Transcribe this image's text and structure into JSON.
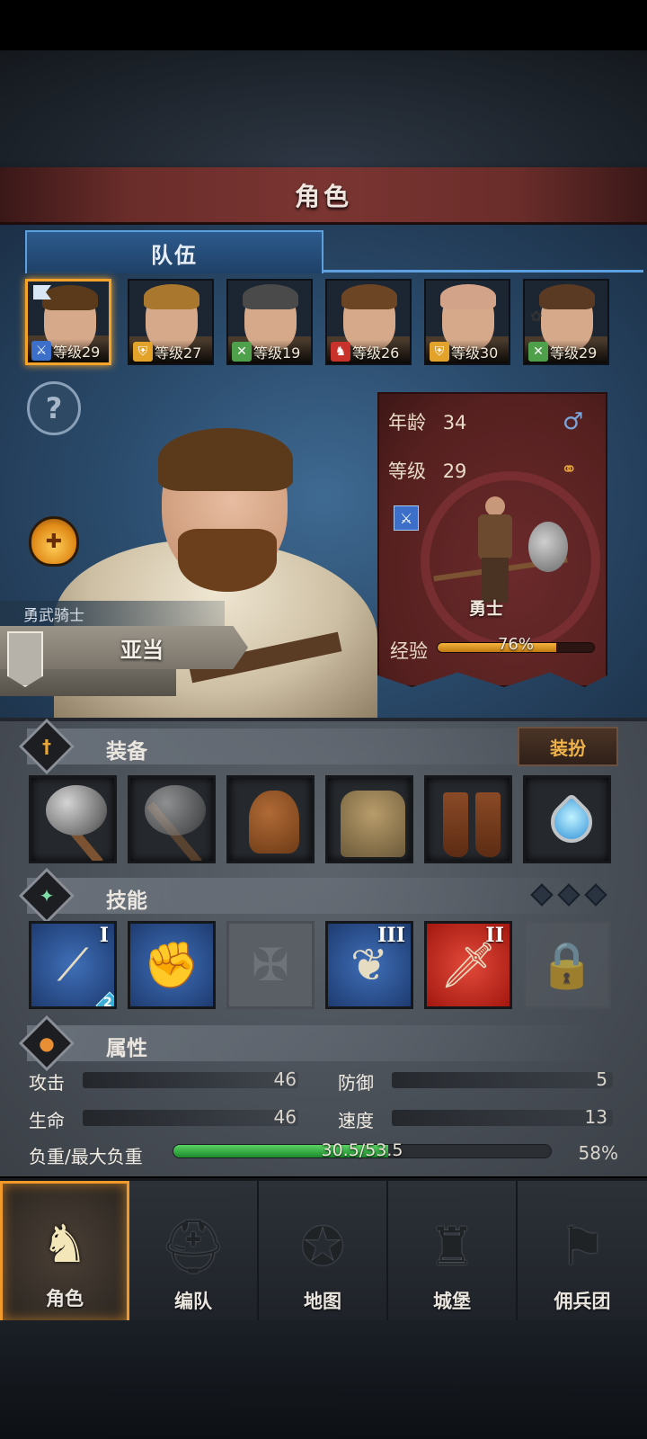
{
  "header": {
    "title": "角色"
  },
  "team": {
    "tab_label": "队伍",
    "members": [
      {
        "level_text": "等级29",
        "class_icon": "sword-icon",
        "color": "#3c6fc9",
        "hair": "#5b3a1c"
      },
      {
        "level_text": "等级27",
        "class_icon": "shield-icon",
        "color": "#e3a22a",
        "hair": "#a9772e"
      },
      {
        "level_text": "等级19",
        "class_icon": "crossed-swords-icon",
        "color": "#4fa04a",
        "hair": "#4a4a4a"
      },
      {
        "level_text": "等级26",
        "class_icon": "horse-icon",
        "color": "#c9312b",
        "hair": "#6b4524"
      },
      {
        "level_text": "等级30",
        "class_icon": "shield-icon",
        "color": "#e3a22a",
        "hair": "#d3a389"
      },
      {
        "level_text": "等级29",
        "class_icon": "crossed-swords-icon",
        "color": "#4fa04a",
        "hair": "#5a3a22"
      }
    ]
  },
  "character": {
    "title": "勇武骑士",
    "name": "亚当",
    "age_label": "年龄",
    "age": "34",
    "level_label": "等级",
    "level": "29",
    "class_name": "勇士",
    "exp_label": "经验",
    "exp_text": "76%",
    "exp_progress": 0.76
  },
  "equipment": {
    "title": "装备",
    "dress_button": "装扮",
    "slots": [
      "axe-icon",
      "axe-icon",
      "helmet-icon",
      "armor-icon",
      "boots-icon",
      "amulet-icon"
    ]
  },
  "skills": {
    "title": "技能",
    "items": [
      {
        "icon": "triple-blade-skill-icon",
        "rank": "I",
        "gem": "2"
      },
      {
        "icon": "fist-skill-icon",
        "rank": "",
        "gem": ""
      },
      {
        "icon": "empty-cross-slot-icon",
        "rank": "",
        "gem": ""
      },
      {
        "icon": "horn-skill-icon",
        "rank": "III",
        "gem": ""
      },
      {
        "icon": "sword-skill-icon",
        "rank": "II",
        "gem": ""
      },
      {
        "icon": "lock-icon",
        "rank": "",
        "gem": ""
      }
    ]
  },
  "attributes": {
    "title": "属性",
    "attack_label": "攻击",
    "attack": "46",
    "defense_label": "防御",
    "defense": "5",
    "hp_label": "生命",
    "hp": "46",
    "speed_label": "速度",
    "speed": "13",
    "load_label": "负重/最大负重",
    "load_text": "30.5/53.5",
    "load_percent": "58%",
    "load_progress": 0.57
  },
  "nav": [
    {
      "label": "角色",
      "icon": "knight-icon"
    },
    {
      "label": "编队",
      "icon": "helmet-team-icon"
    },
    {
      "label": "地图",
      "icon": "compass-map-icon"
    },
    {
      "label": "城堡",
      "icon": "castle-icon"
    },
    {
      "label": "佣兵团",
      "icon": "mercenary-icon"
    }
  ]
}
